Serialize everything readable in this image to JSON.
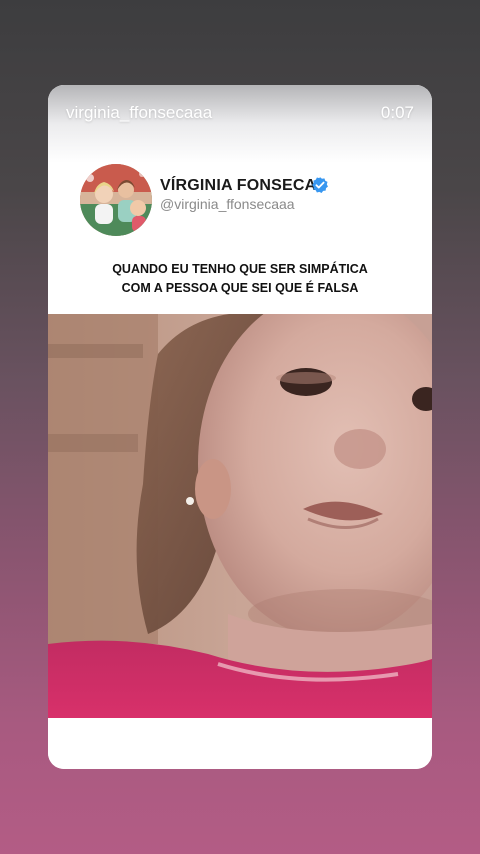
{
  "story": {
    "username": "virginia_ffonsecaaa",
    "elapsed_time": "0:07"
  },
  "post": {
    "author_name": "VÍRGINIA FONSECA",
    "author_handle": "@virginia_ffonsecaaa",
    "verified": true,
    "caption_lines": [
      "QUANDO EU TENHO QUE SER SIMPÁTICA",
      "COM A PESSOA QUE SEI QUE É FALSA"
    ]
  },
  "colors": {
    "verified_badge": "#3897f0",
    "shirt": "#d8306a"
  },
  "icons": {
    "verified": "verified-badge-icon"
  }
}
